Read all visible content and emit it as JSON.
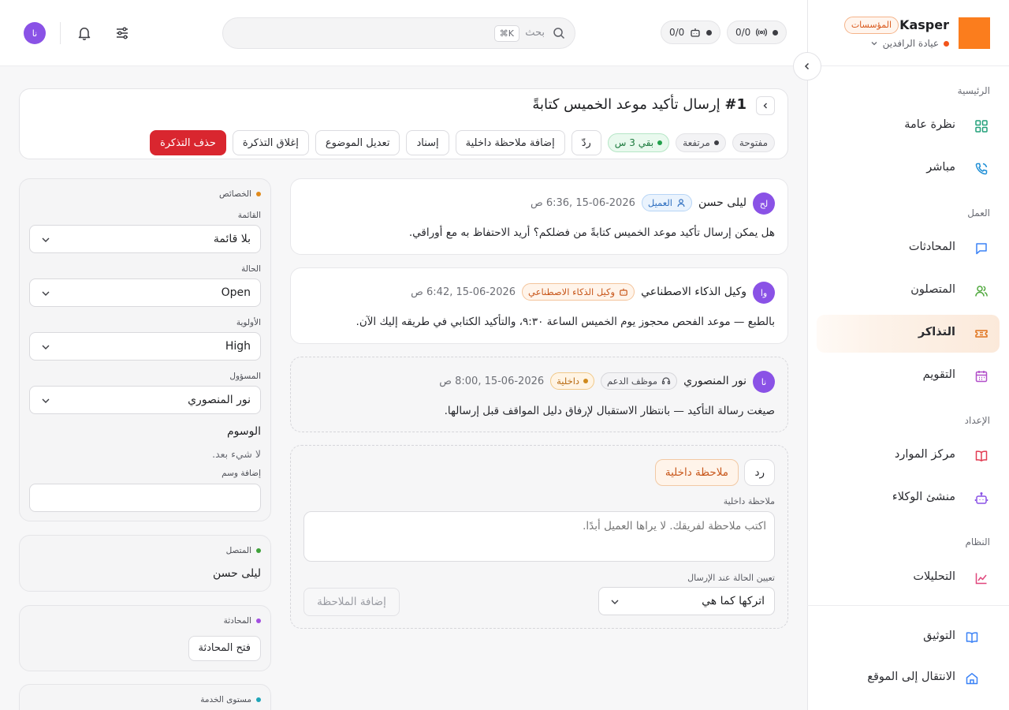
{
  "brand": {
    "name": "Kasper",
    "plan_badge": "المؤسسات",
    "org_name": "عيادة الرافدين",
    "logo_color": "#fb7d1d"
  },
  "sidebar": {
    "sections": [
      {
        "title": "الرئيسية"
      },
      {
        "title": "العمل"
      },
      {
        "title": "الإعداد"
      },
      {
        "title": "النظام"
      }
    ],
    "items": [
      {
        "label": "نظرة عامة",
        "icon": "grid-icon"
      },
      {
        "label": "مباشر",
        "icon": "phone-icon"
      },
      {
        "label": "المحادثات",
        "icon": "chat-icon"
      },
      {
        "label": "المتصلون",
        "icon": "users-icon"
      },
      {
        "label": "التذاكر",
        "icon": "ticket-icon",
        "active": true
      },
      {
        "label": "التقويم",
        "icon": "calendar-icon"
      },
      {
        "label": "مركز الموارد",
        "icon": "book-icon"
      },
      {
        "label": "منشئ الوكلاء",
        "icon": "robot-icon"
      },
      {
        "label": "التحليلات",
        "icon": "chart-icon"
      }
    ],
    "footer": [
      {
        "label": "التوثيق",
        "icon": "docs-icon"
      },
      {
        "label": "الانتقال إلى الموقع",
        "icon": "home-icon"
      }
    ]
  },
  "topbar": {
    "search_placeholder": "بحث",
    "search_shortcut": "⌘K",
    "counter_calls": "0/0",
    "counter_agents": "0/0",
    "user_initials": "نا"
  },
  "ticket": {
    "number": "#1",
    "title": "إرسال تأكيد موعد الخميس كتابةً",
    "status": "مفتوحة",
    "priority": "مرتفعة",
    "sla": "بقي 3 س",
    "actions": {
      "reply": "ردّ",
      "add_note": "إضافة ملاحظة داخلية",
      "assign": "إسناد",
      "edit_subject": "تعديل الموضوع",
      "close": "إغلاق التذكرة",
      "delete": "حذف التذكرة"
    }
  },
  "messages": [
    {
      "initials": "لح",
      "avatar_color": "#8a52e6",
      "name": "ليلى حسن",
      "badge": "العميل",
      "time": "15-06-2026 ,6:36 ص",
      "body": "هل يمكن إرسال تأكيد موعد الخميس كتابةً من فضلكم؟ أريد الاحتفاظ به مع أوراقي."
    },
    {
      "initials": "وا",
      "avatar_color": "#8a52e6",
      "name": "وكيل الذكاء الاصطناعي",
      "badge": "وكيل الذكاء الاصطناعي",
      "time": "15-06-2026 ,6:42 ص",
      "body": "بالطبع — موعد الفحص محجوز يوم الخميس الساعة ٩:٣٠، والتأكيد الكتابي في طريقه إليك الآن."
    },
    {
      "initials": "نا",
      "avatar_color": "#8a52e6",
      "name": "نور المنصوري",
      "badge": "موظف الدعم",
      "badge2": "داخلية",
      "time": "15-06-2026 ,8:00 ص",
      "body": "صيغت رسالة التأكيد — بانتظار الاستقبال لإرفاق دليل المواقف قبل إرسالها."
    }
  ],
  "composer": {
    "tab_reply": "رد",
    "tab_note": "ملاحظة داخلية",
    "note_label": "ملاحظة داخلية",
    "note_placeholder": "اكتب ملاحظة لفريقك. لا يراها العميل أبدًا.",
    "status_label": "تعيين الحالة عند الإرسال",
    "status_value": "اتركها كما هي",
    "submit": "إضافة الملاحظة"
  },
  "properties": {
    "title": "الخصائص",
    "list_label": "القائمة",
    "list_value": "بلا قائمة",
    "status_label": "الحالة",
    "status_value": "Open",
    "priority_label": "الأولوية",
    "priority_value": "High",
    "owner_label": "المسؤول",
    "owner_value": "نور المنصوري",
    "tags_title": "الوسوم",
    "tags_empty": "لا شيء بعد.",
    "add_tag_label": "إضافة وسم"
  },
  "contact_card": {
    "title": "المتصل",
    "value": "ليلى حسن"
  },
  "conversation_card": {
    "title": "المحادثة",
    "button": "فتح المحادثة"
  },
  "sla_card": {
    "title": "مستوى الخدمة"
  }
}
